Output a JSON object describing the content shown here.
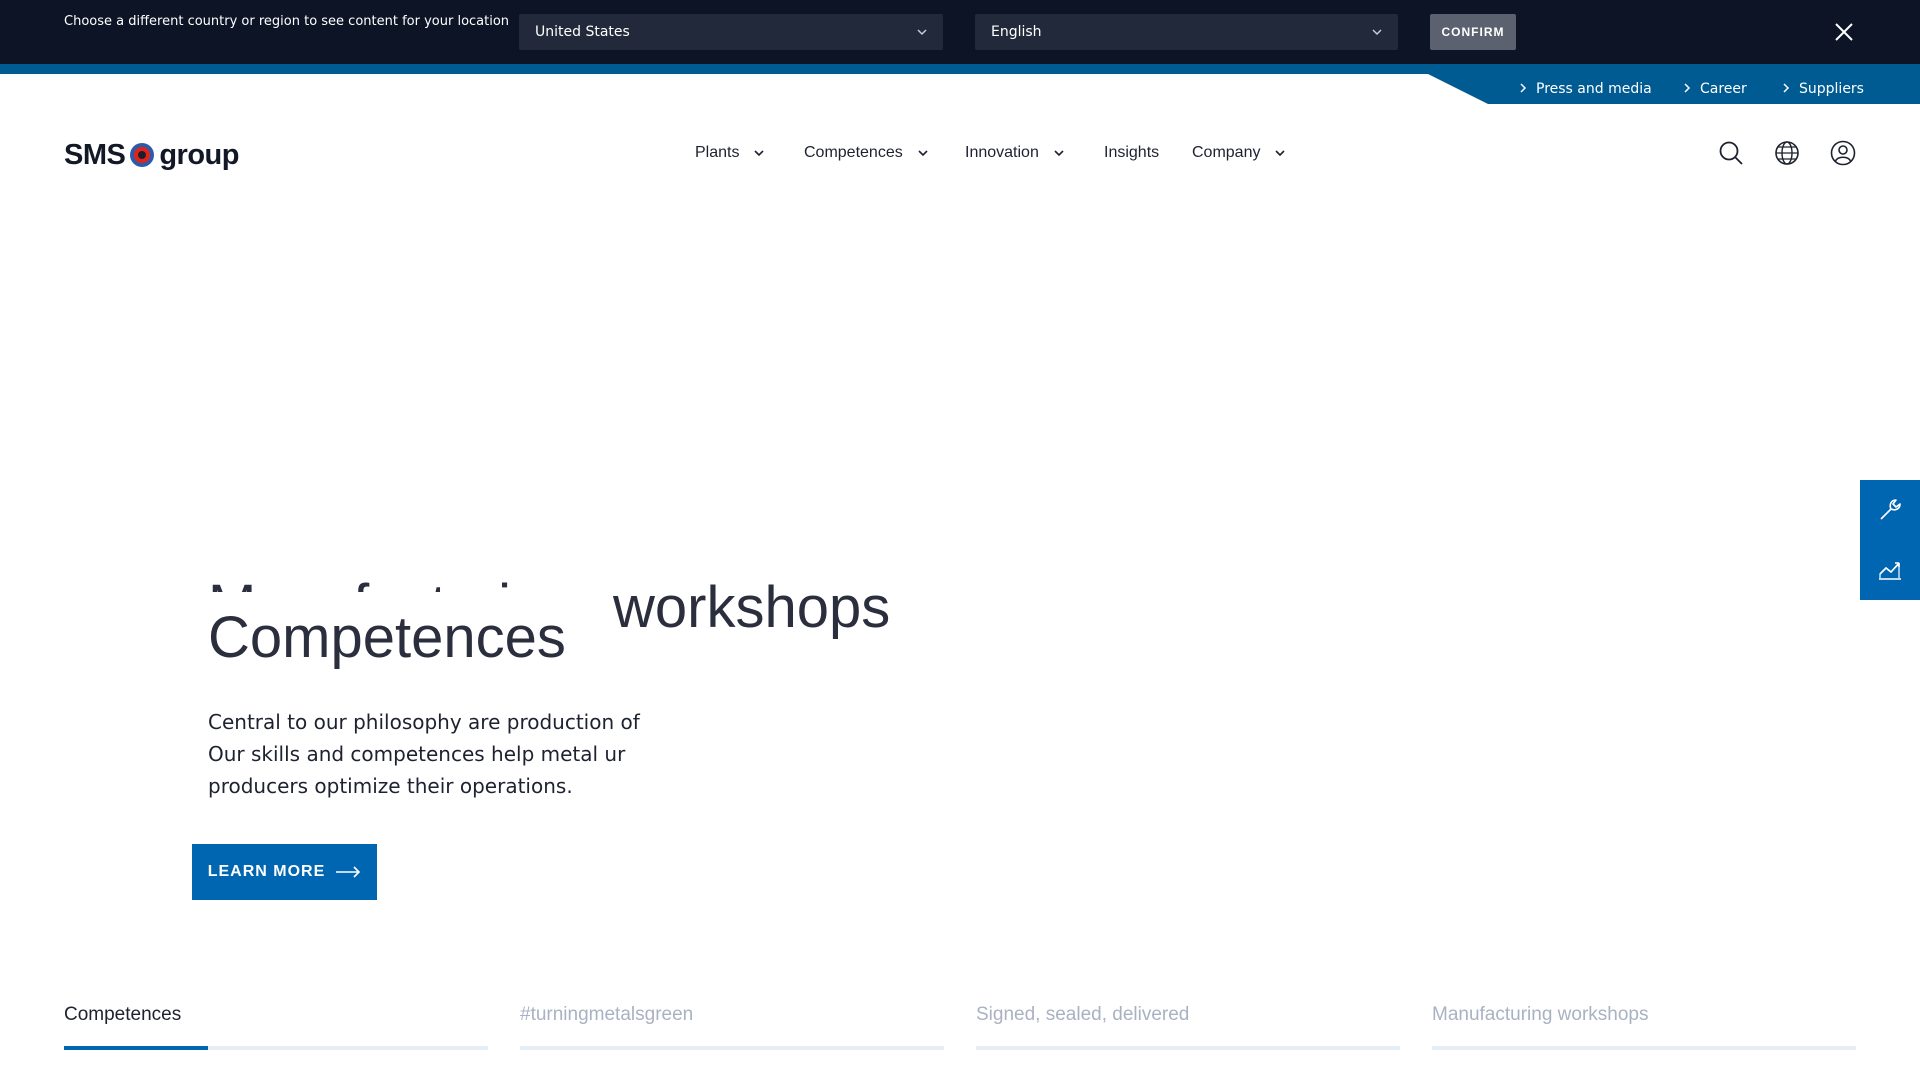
{
  "country_bar": {
    "prompt": "Choose a different country or region to see content for your location",
    "country_value": "United States",
    "language_value": "English",
    "confirm_label": "CONFIRM"
  },
  "service_nav": {
    "links": [
      "Press and media",
      "Career",
      "Suppliers"
    ]
  },
  "header": {
    "logo_left": "SMS",
    "logo_right": "group",
    "nav": [
      {
        "label": "Plants",
        "has_dropdown": true
      },
      {
        "label": "Competences",
        "has_dropdown": true
      },
      {
        "label": "Innovation",
        "has_dropdown": true
      },
      {
        "label": "Insights",
        "has_dropdown": false
      },
      {
        "label": "Company",
        "has_dropdown": true
      }
    ],
    "icons": [
      "search-icon",
      "globe-icon",
      "user-icon"
    ]
  },
  "hero": {
    "ghost_title": "Manufacturing",
    "ghost_suffix": "workshops",
    "title": "Competences",
    "body_lines": [
      "Central to our philosophy are production of",
      "Our skills and competences help metal   ur",
      "producers optimize their operations."
    ],
    "cta_label": "LEARN MORE"
  },
  "side_tabs": [
    "wrench-icon",
    "chart-icon"
  ],
  "bottom_tabs": {
    "items": [
      "Competences",
      "#turningmetalsgreen",
      "Signed, sealed, delivered",
      "Manufacturing workshops"
    ],
    "active_index": 0,
    "active_progress": 0.34
  },
  "colors": {
    "brand_blue": "#0066b2",
    "dark_navy": "#0c1425",
    "service_blue": "#005b93"
  }
}
